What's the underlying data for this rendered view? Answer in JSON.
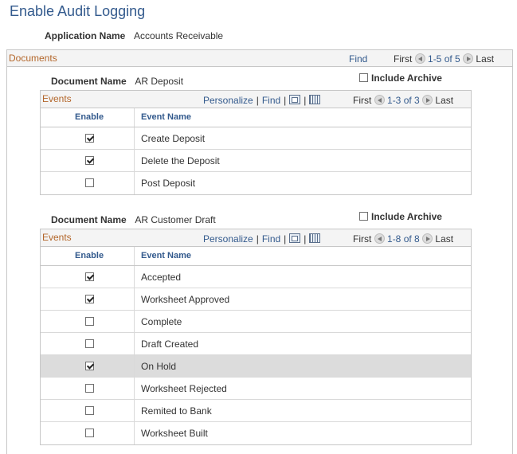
{
  "page": {
    "title": "Enable Audit Logging"
  },
  "application": {
    "label": "Application Name",
    "value": "Accounts Receivable"
  },
  "documents": {
    "title": "Documents",
    "find": "Find",
    "first": "First",
    "range": "1-5 of 5",
    "last": "Last",
    "items": [
      {
        "doc_label": "Document Name",
        "doc_value": "AR Deposit",
        "include_archive": {
          "label": "Include Archive",
          "checked": false
        },
        "events": {
          "title": "Events",
          "personalize": "Personalize",
          "find": "Find",
          "first": "First",
          "range": "1-3 of 3",
          "last": "Last",
          "col_enable": "Enable",
          "col_event": "Event Name",
          "rows": [
            {
              "enabled": true,
              "name": "Create Deposit"
            },
            {
              "enabled": true,
              "name": "Delete the Deposit"
            },
            {
              "enabled": false,
              "name": "Post Deposit"
            }
          ]
        }
      },
      {
        "doc_label": "Document Name",
        "doc_value": "AR Customer Draft",
        "include_archive": {
          "label": "Include Archive",
          "checked": false
        },
        "events": {
          "title": "Events",
          "personalize": "Personalize",
          "find": "Find",
          "first": "First",
          "range": "1-8 of 8",
          "last": "Last",
          "col_enable": "Enable",
          "col_event": "Event Name",
          "rows": [
            {
              "enabled": true,
              "name": "Accepted"
            },
            {
              "enabled": true,
              "name": "Worksheet Approved"
            },
            {
              "enabled": false,
              "name": "Complete"
            },
            {
              "enabled": false,
              "name": "Draft Created"
            },
            {
              "enabled": true,
              "name": "On Hold",
              "highlighted": true
            },
            {
              "enabled": false,
              "name": "Worksheet Rejected"
            },
            {
              "enabled": false,
              "name": "Remited to Bank"
            },
            {
              "enabled": false,
              "name": "Worksheet Built"
            }
          ]
        }
      }
    ]
  }
}
